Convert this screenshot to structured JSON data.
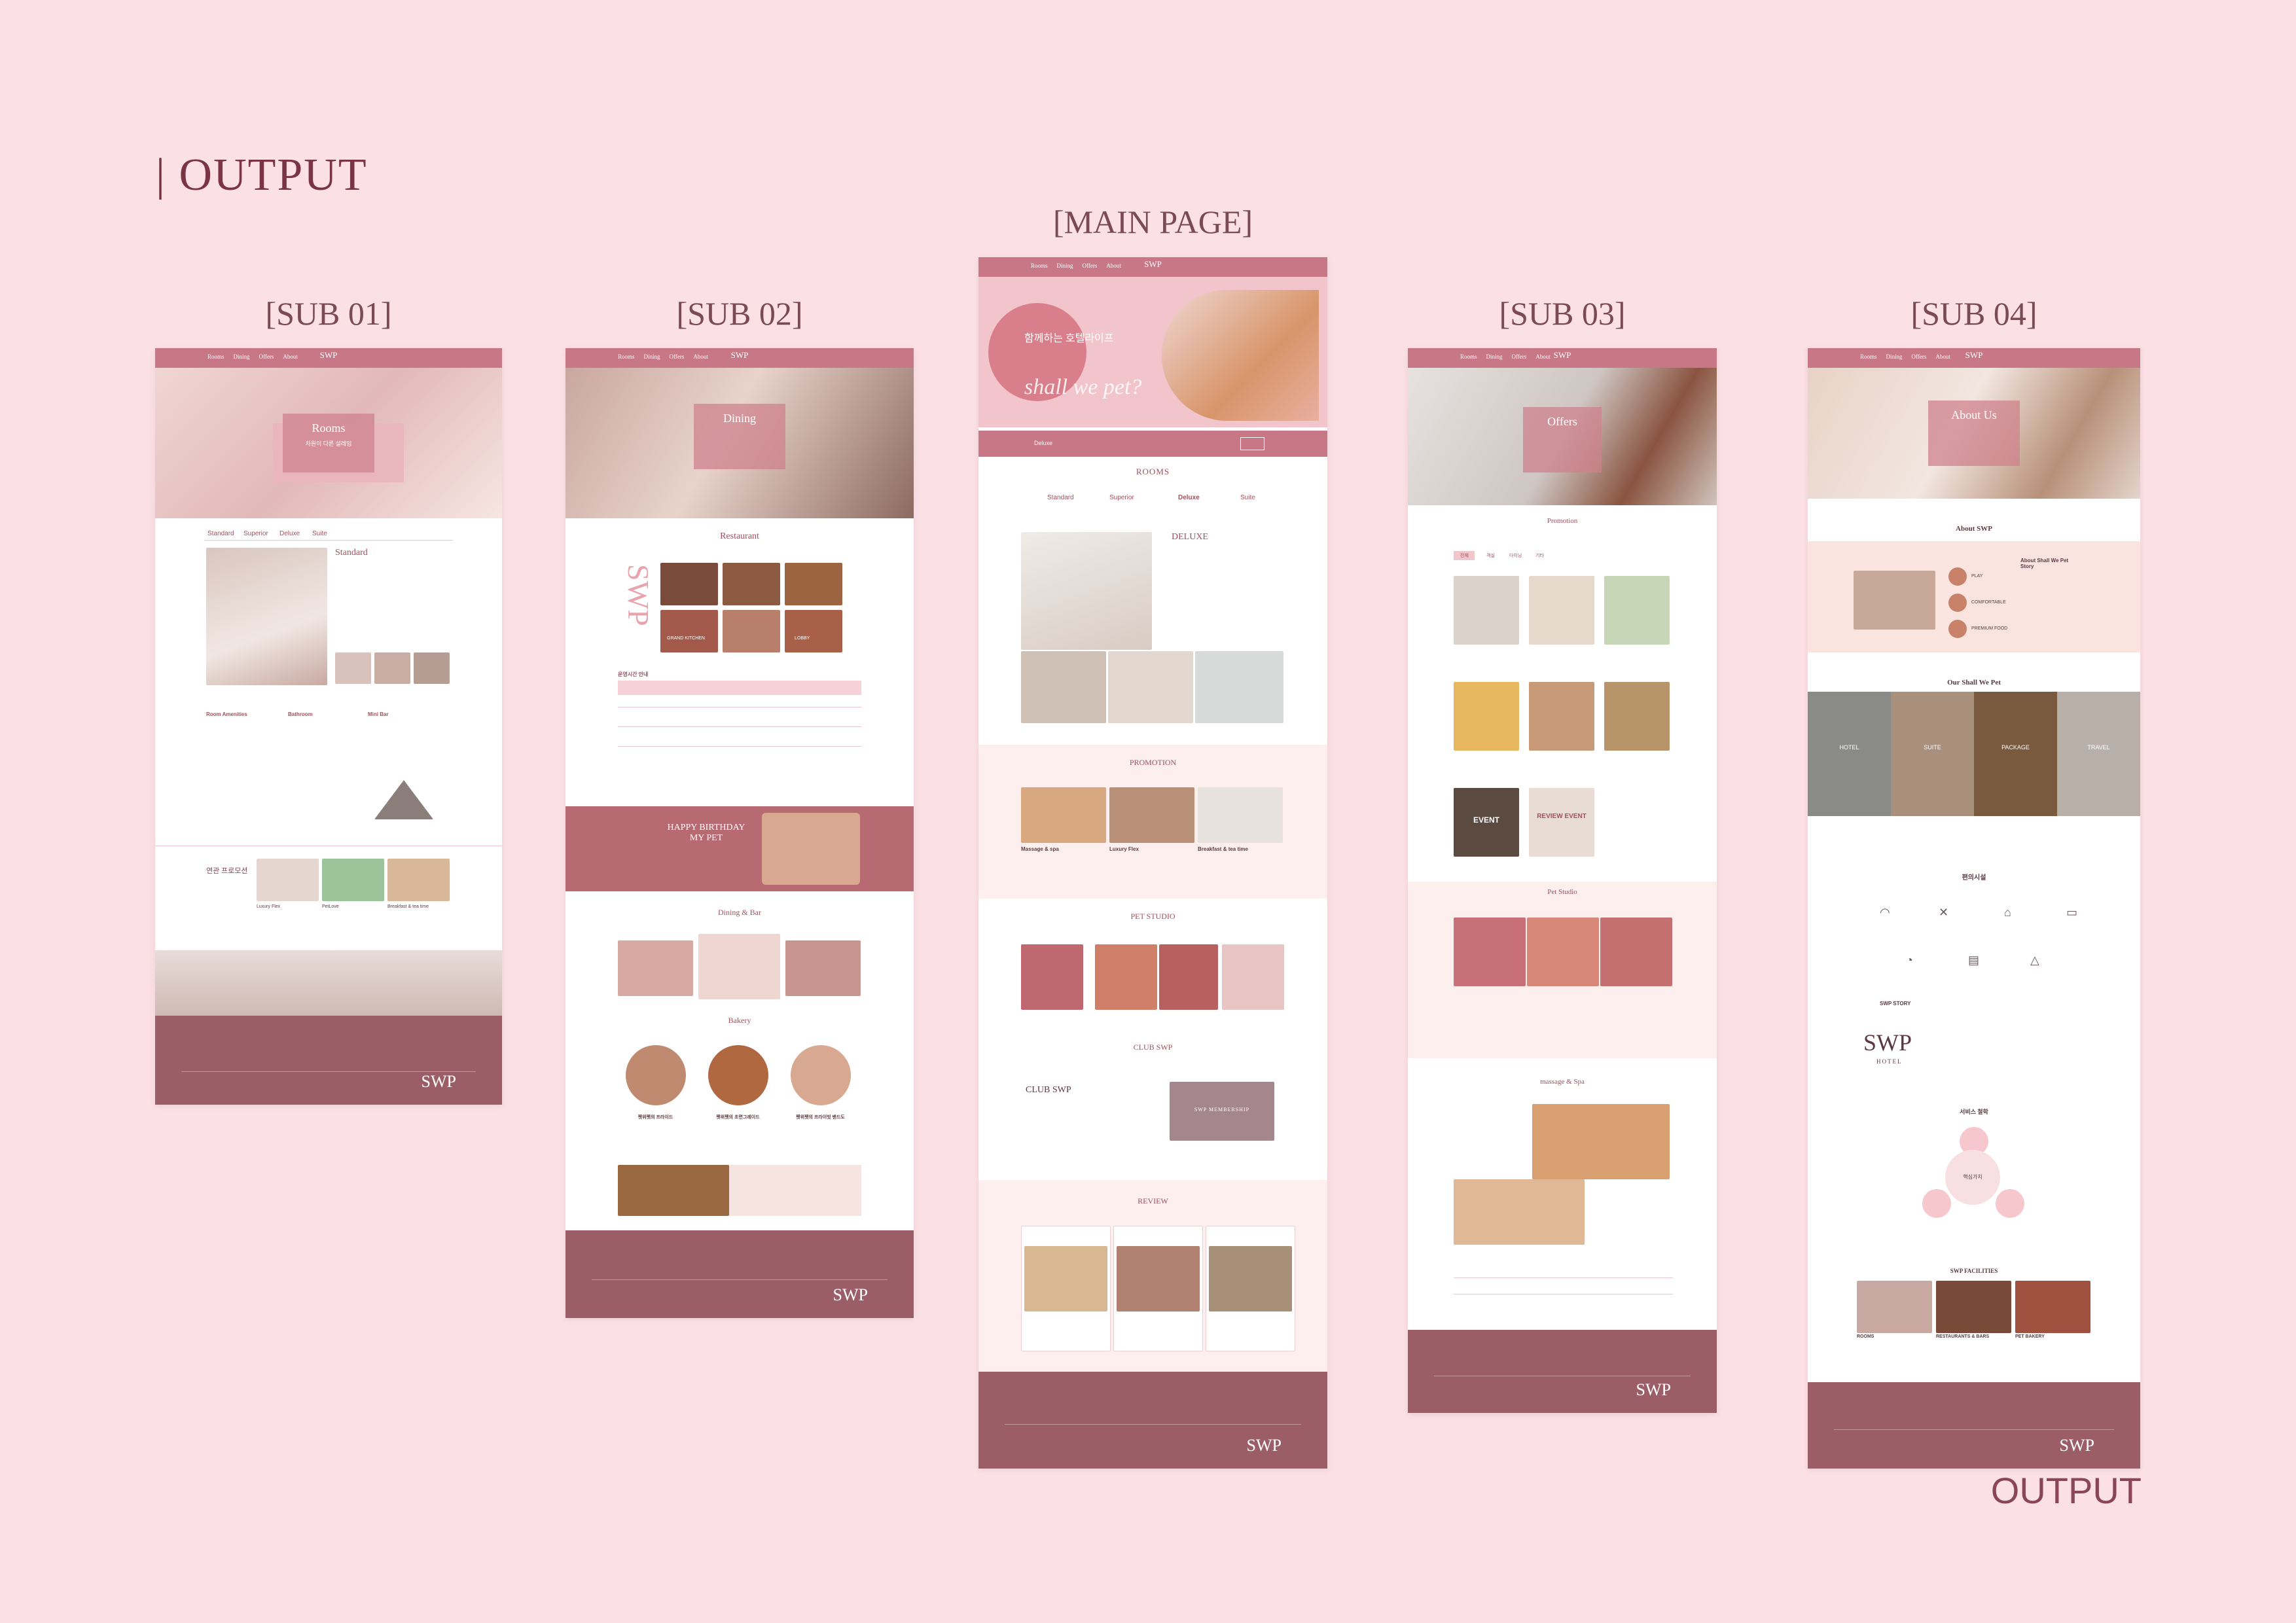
{
  "heading": "| OUTPUT",
  "output_label": "OUTPUT",
  "colors": {
    "background": "#fbe1e6",
    "brand": "#c77785",
    "footer": "#9b5e66",
    "accent": "#a0505e"
  },
  "pages": {
    "sub01": {
      "title": "[SUB 01]",
      "hero_title": "Rooms",
      "hero_sub": "차원이 다른 설레임",
      "tabs": [
        "Standard",
        "Superior",
        "Deluxe",
        "Suite"
      ],
      "room_name": "Standard",
      "amenity_heads": [
        "Room Amenities",
        "Bathroom",
        "Mini Bar"
      ],
      "promo_title": "연관 프로모션",
      "promos": [
        "Luxury Flex",
        "PetLove",
        "Breakfast & tea time"
      ]
    },
    "sub02": {
      "title": "[SUB 02]",
      "hero_title": "Dining",
      "section1": "Restaurant",
      "side_logo": "SWP",
      "venue_labels": [
        "GRAND KITCHEN",
        "LOBBY"
      ],
      "table_title": "운영시간 안내",
      "banner": "HAPPY BIRTHDAY MY PET",
      "section2": "Dining & Bar",
      "section3": "Bakery",
      "bakery_items": [
        "펫위펫의 프라이드",
        "펫위펫의 초면그레이드",
        "펫위펫의 프라이빗 밴드도"
      ]
    },
    "main": {
      "title": "[MAIN PAGE]",
      "hero_kr": "함께하는 호텔라이프",
      "hero_script": "shall we pet?",
      "booking_room": "Deluxe",
      "rooms_title": "ROOMS",
      "room_tabs": [
        "Standard",
        "Superior",
        "Deluxe",
        "Suite"
      ],
      "room_name": "DELUXE",
      "promotion_title": "PROMOTION",
      "promotions": [
        "Massage & spa",
        "Luxury Flex",
        "Breakfast & tea time"
      ],
      "studio_title": "PET STUDIO",
      "club_title": "CLUB SWP",
      "club_sub": "CLUB SWP",
      "club_card": "SWP MEMBERSHIP",
      "review_title": "REVIEW"
    },
    "sub03": {
      "title": "[SUB 03]",
      "hero_title": "Offers",
      "section1": "Promotion",
      "tabs": [
        "전체",
        "객실",
        "다이닝",
        "기타"
      ],
      "event_tiles": [
        "EVENT",
        "REVIEW EVENT"
      ],
      "section2": "Pet Studio",
      "section3": "massage & Spa"
    },
    "sub04": {
      "title": "[SUB 04]",
      "hero_title": "About Us",
      "about_title": "About SWP",
      "about_items": [
        "PLAY",
        "COMFORTABLE",
        "PREMIUM FOOD"
      ],
      "about_story": "About Shall We Pet Story",
      "our_title": "Our Shall We Pet",
      "our_items": [
        "HOTEL",
        "SUITE",
        "PACKAGE",
        "TRAVEL"
      ],
      "facility_title": "편의시설",
      "story_label": "SWP STORY",
      "big_logo": "SWP",
      "big_logo_sub": "HOTEL",
      "philosophy_title": "서비스 철학",
      "philosophy_center": "핵심가치",
      "facilities_title": "SWP FACILITIES",
      "facilities": [
        "ROOMS",
        "RESTAURANTS & BARS",
        "PET BAKERY"
      ]
    }
  },
  "nav": {
    "links": [
      "Rooms",
      "Dining",
      "Offers",
      "About"
    ],
    "logo": "SWP"
  }
}
